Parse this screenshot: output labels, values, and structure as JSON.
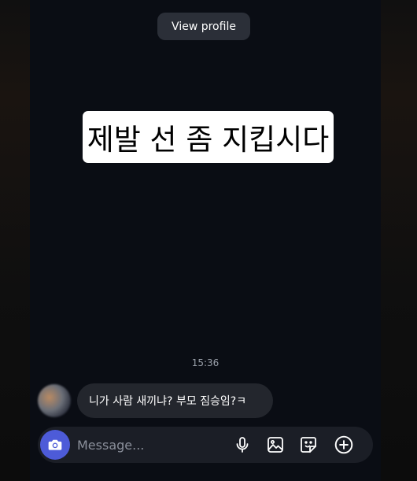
{
  "header": {
    "view_profile_label": "View profile"
  },
  "story": {
    "text": "제발 선 좀 지킵시다"
  },
  "conversation": {
    "timestamp": "15:36",
    "messages": [
      {
        "text": "니가 사람 새끼냐? 부모 짐승임?ㅋ"
      }
    ]
  },
  "composer": {
    "placeholder": "Message...",
    "icons": [
      "camera-icon",
      "microphone-icon",
      "gallery-icon",
      "sticker-icon",
      "plus-circle-icon"
    ]
  },
  "colors": {
    "background": "#0a0d14",
    "camera_button": "#4d5bd8",
    "bubble": "#23262d",
    "composer": "#1b1e26"
  }
}
